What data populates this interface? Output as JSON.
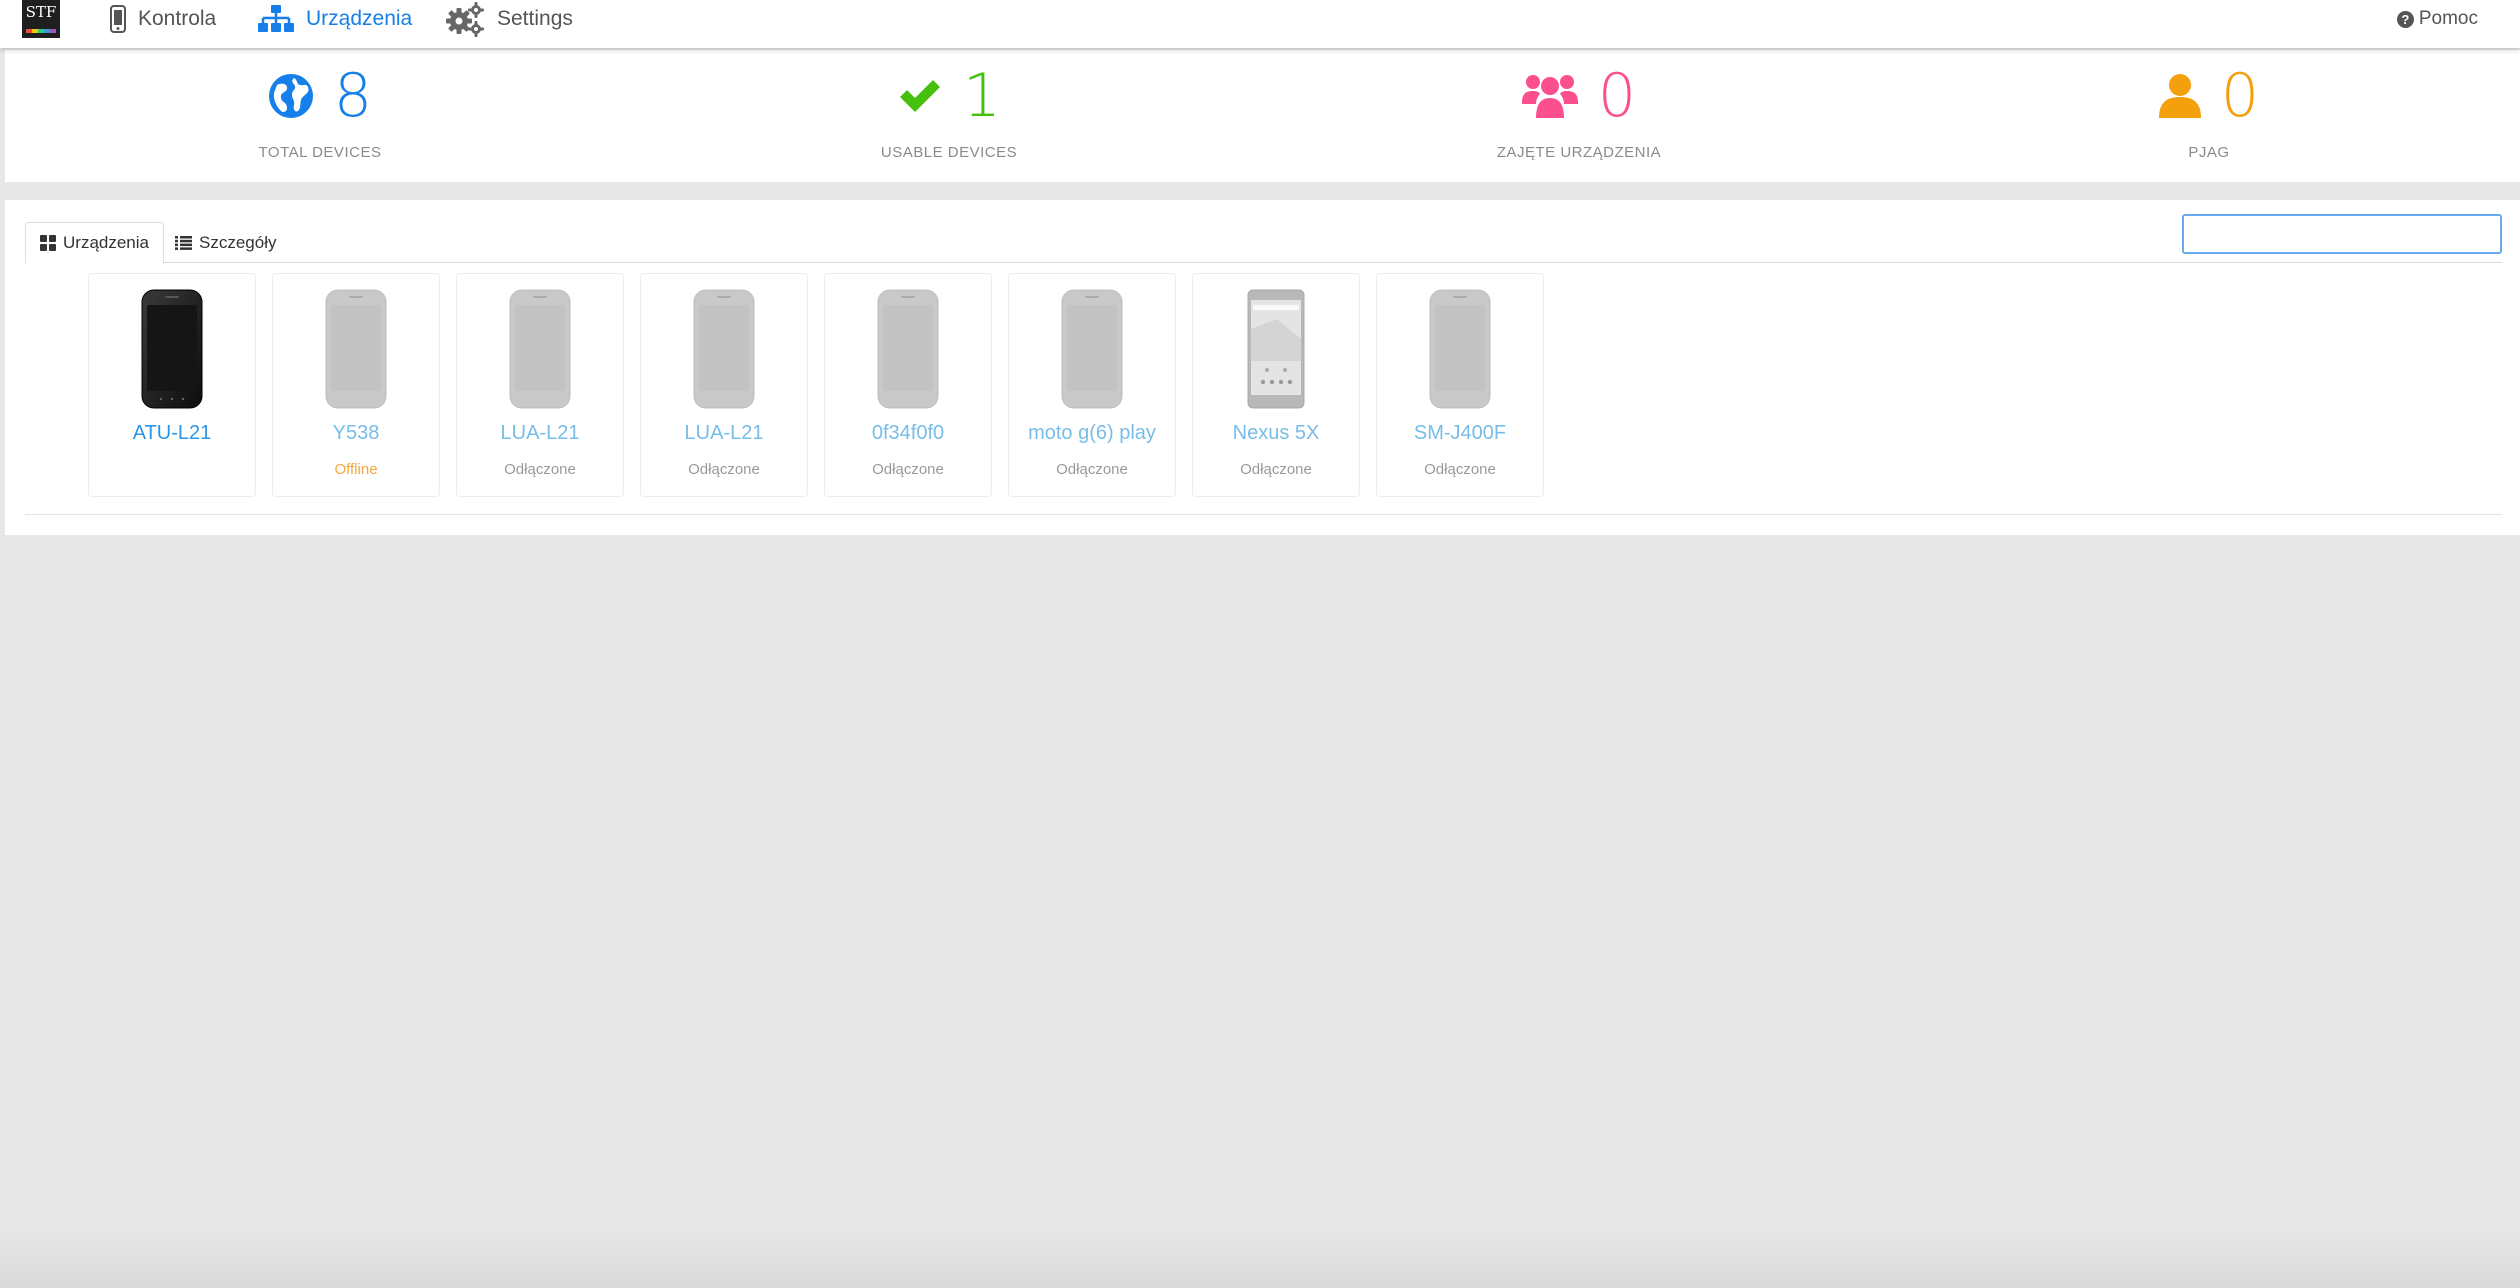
{
  "app": {
    "logo_text": "STF"
  },
  "nav": {
    "items": [
      {
        "label": "Kontrola",
        "icon": "mobile-phone-icon",
        "active": false
      },
      {
        "label": "Urządzenia",
        "icon": "sitemap-icon",
        "active": true
      },
      {
        "label": "Settings",
        "icon": "gears-icon",
        "active": false
      }
    ],
    "help_label": "Pomoc"
  },
  "stats": [
    {
      "value": "8",
      "label": "TOTAL DEVICES",
      "icon": "globe-icon",
      "color": "#167fea"
    },
    {
      "value": "1",
      "label": "USABLE DEVICES",
      "icon": "check-icon",
      "color": "#45c10d"
    },
    {
      "value": "0",
      "label": "ZAJĘTE URZĄDZENIA",
      "icon": "users-icon",
      "color": "#fb4f8e"
    },
    {
      "value": "0",
      "label": "PJAG",
      "icon": "user-icon",
      "color": "#f4a00c"
    }
  ],
  "devices_panel": {
    "tabs": [
      {
        "label": "Urządzenia",
        "icon": "th-large-icon",
        "active": true
      },
      {
        "label": "Szczegóły",
        "icon": "list-icon",
        "active": false
      }
    ],
    "search": {
      "value": "",
      "placeholder": ""
    }
  },
  "devices": [
    {
      "name": "ATU-L21",
      "status": "",
      "state": "available"
    },
    {
      "name": "Y538",
      "status": "Offline",
      "state": "offline"
    },
    {
      "name": "LUA-L21",
      "status": "Odłączone",
      "state": "disconnected"
    },
    {
      "name": "LUA-L21",
      "status": "Odłączone",
      "state": "disconnected"
    },
    {
      "name": "0f34f0f0",
      "status": "Odłączone",
      "state": "disconnected"
    },
    {
      "name": "moto g(6) play",
      "status": "Odłączone",
      "state": "disconnected"
    },
    {
      "name": "Nexus 5X",
      "status": "Odłączone",
      "state": "disconnected"
    },
    {
      "name": "SM-J400F",
      "status": "Odłączone",
      "state": "disconnected"
    }
  ]
}
